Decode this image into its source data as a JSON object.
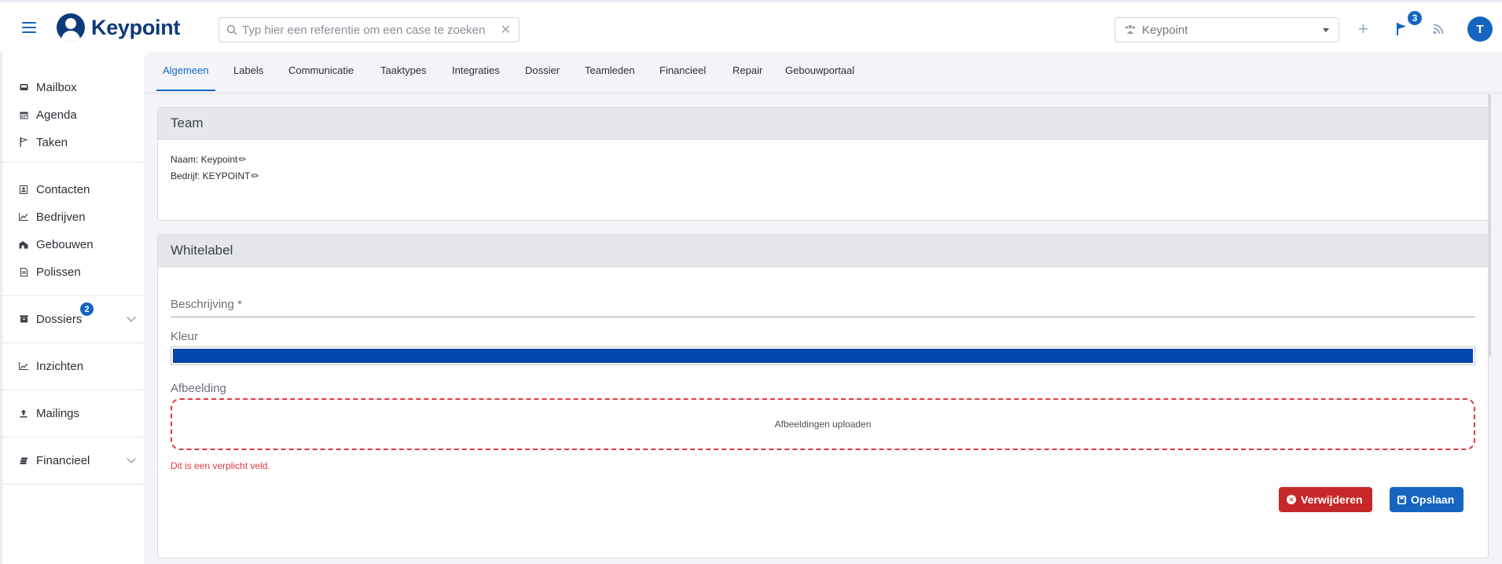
{
  "app": {
    "name": "Keypoint"
  },
  "header": {
    "search_placeholder": "Typ hier een referentie om een case te zoeken",
    "team_selector_value": "Keypoint",
    "notification_count": "3",
    "avatar_initial": "T"
  },
  "sidebar": {
    "items": [
      {
        "label": "Mailbox",
        "icon": "mailbox-icon"
      },
      {
        "label": "Agenda",
        "icon": "calendar-icon"
      },
      {
        "label": "Taken",
        "icon": "flag-icon"
      },
      {
        "label": "Contacten",
        "icon": "contact-card-icon"
      },
      {
        "label": "Bedrijven",
        "icon": "chart-icon"
      },
      {
        "label": "Gebouwen",
        "icon": "building-icon"
      },
      {
        "label": "Polissen",
        "icon": "document-icon"
      },
      {
        "label": "Dossiers",
        "icon": "archive-icon",
        "badge": "2"
      },
      {
        "label": "Inzichten",
        "icon": "trend-chart-icon"
      },
      {
        "label": "Mailings",
        "icon": "upload-icon"
      },
      {
        "label": "Financieel",
        "icon": "coins-icon"
      }
    ]
  },
  "tabs": [
    {
      "label": "Algemeen",
      "active": true
    },
    {
      "label": "Labels"
    },
    {
      "label": "Communicatie"
    },
    {
      "label": "Taaktypes"
    },
    {
      "label": "Integraties"
    },
    {
      "label": "Dossier"
    },
    {
      "label": "Teamleden"
    },
    {
      "label": "Financieel"
    },
    {
      "label": "Repair"
    },
    {
      "label": "Gebouwportaal"
    }
  ],
  "team_card": {
    "title": "Team",
    "name_line": "Naam: Keypoint",
    "company_line": "Bedrijf: KEYPOINT"
  },
  "whitelabel_card": {
    "title": "Whitelabel",
    "description_label": "Beschrijving *",
    "color_label": "Kleur",
    "color_value": "#0047ab",
    "image_label": "Afbeelding",
    "upload_text": "Afbeeldingen uploaden",
    "error_text": "Dit is een verplicht veld.",
    "delete_button": "Verwijderen",
    "save_button": "Opslaan"
  },
  "colors": {
    "primary": "#1565c0",
    "brand": "#0d3a7a",
    "danger": "#c62828",
    "error": "#e0393e"
  }
}
